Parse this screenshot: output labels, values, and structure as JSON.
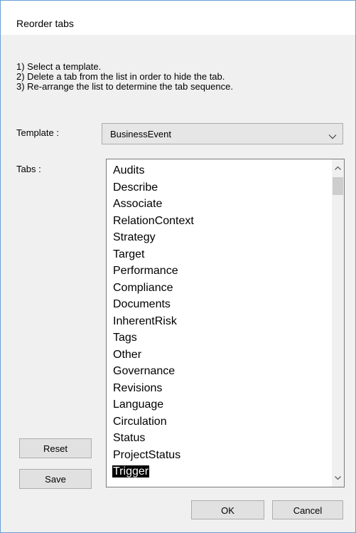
{
  "window": {
    "title": "Reorder tabs"
  },
  "instructions": [
    "1) Select a template.",
    "2) Delete a tab from the list in order to hide the tab.",
    "3) Re-arrange the list to determine the tab sequence."
  ],
  "template": {
    "label": "Template :",
    "selected_value": "BusinessEvent",
    "chevron_icon": "chevron-down-icon"
  },
  "tabs": {
    "label": "Tabs :",
    "items": [
      "Audits",
      "Describe",
      "Associate",
      "RelationContext",
      "Strategy",
      "Target",
      "Performance",
      "Compliance",
      "Documents",
      "InherentRisk",
      "Tags",
      "Other",
      "Governance",
      "Revisions",
      "Language",
      "Circulation",
      "Status",
      "ProjectStatus",
      "Trigger"
    ],
    "selected_item": "Trigger"
  },
  "buttons": {
    "reset": "Reset",
    "save": "Save",
    "ok": "OK",
    "cancel": "Cancel"
  },
  "colors": {
    "window_border": "#6a9fd4",
    "selection_bg": "#000000",
    "selection_fg": "#ffffff",
    "dialog_bg": "#f0f0f0"
  }
}
